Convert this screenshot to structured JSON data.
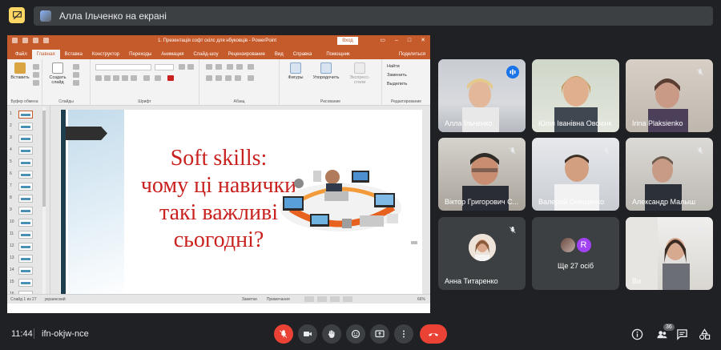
{
  "top_bar": {
    "presenter_label": "Алла Ільченко на екрані"
  },
  "powerpoint": {
    "window_title": "1. Презентація софт скілс для нбуковців  -  PowerPoint",
    "login_button": "Вход",
    "tabs": [
      "Файл",
      "Главная",
      "Вставка",
      "Конструктор",
      "Переходы",
      "Анимация",
      "Слайд-шоу",
      "Рецензирование",
      "Вид",
      "Справка"
    ],
    "active_tab": "Главная",
    "tell_me": "Помощник",
    "share": "Поделиться",
    "ribbon": {
      "paste": "Вставить",
      "new_slide": "Создать слайд",
      "shapes": "Фигуры",
      "arrange": "Упорядочить",
      "quick_styles": "Экспресс-стили",
      "find": "Найти",
      "replace": "Заменить",
      "select": "Выделить",
      "groups": [
        "Буфер обмена",
        "Слайды",
        "Шрифт",
        "Абзац",
        "Рисование",
        "Редактирование"
      ]
    },
    "thumbnails": [
      "1",
      "2",
      "3",
      "4",
      "5",
      "6",
      "7",
      "8",
      "9",
      "10",
      "11",
      "12",
      "13",
      "14",
      "15",
      "16"
    ],
    "slide": {
      "title_lines": [
        "Soft skills:",
        "чому ці навички",
        "такі важливі",
        "сьогодні?"
      ]
    },
    "status": {
      "slide_counter": "Слайд 1 из 27",
      "language": "украинский",
      "notes": "Заметки",
      "comments": "Примечания",
      "zoom": "66%"
    }
  },
  "participants": [
    {
      "name": "Алла Ільченко",
      "mic": "speaking",
      "highlight": true
    },
    {
      "name": "Юлія Іванівна Овсієнко",
      "mic": "none"
    },
    {
      "name": "Irina Plaksienko",
      "mic": "muted"
    },
    {
      "name": "Віктор Григорович С...",
      "mic": "muted"
    },
    {
      "name": "Валерий Онищенко",
      "mic": "muted"
    },
    {
      "name": "Александр Малыш",
      "mic": "muted"
    },
    {
      "name": "Анна Титаренко",
      "mic": "muted"
    },
    {
      "name": "Ще 27 осіб",
      "mic": "none",
      "avatar_letter": "R"
    },
    {
      "name": "Ви",
      "mic": "muted"
    }
  ],
  "bottom_bar": {
    "time": "11:44",
    "meeting_code": "ifn-okjw-nce",
    "people_count": "36"
  },
  "colors": {
    "meet_bg": "#202124",
    "tile_bg": "#3c4043",
    "accent_blue": "#8ab4f8",
    "danger_red": "#ea4335",
    "ppt_orange": "#c55a2b",
    "slide_title_red": "#c9211e"
  }
}
